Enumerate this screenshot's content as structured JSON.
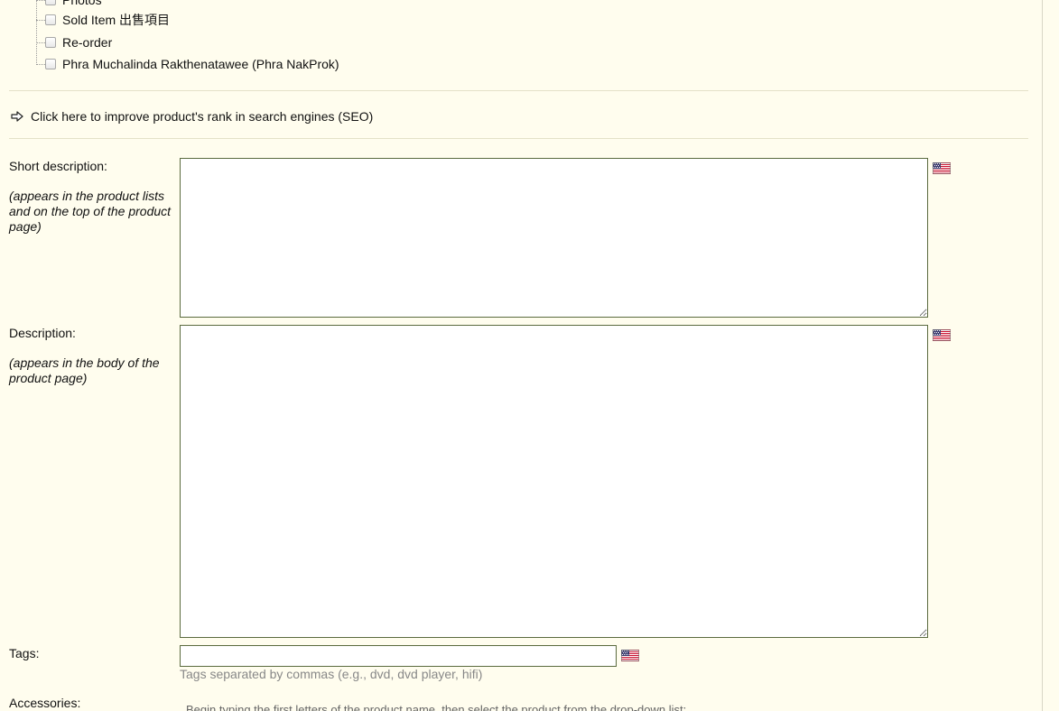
{
  "category_tree": {
    "items": [
      {
        "label": "Photos"
      },
      {
        "label": "Sold Item 出售項目"
      },
      {
        "label": "Re-order"
      },
      {
        "label": "Phra Muchalinda Rakthenatawee (Phra NakProk)"
      }
    ]
  },
  "seo_link": {
    "icon": "arrow-right-icon",
    "label": "Click here to improve product's rank in search engines (SEO)"
  },
  "short_description": {
    "label": "Short description:",
    "hint": "(appears in the product lists and on the top of the product page)",
    "value": "",
    "language_icon": "us-flag-icon"
  },
  "description": {
    "label": "Description:",
    "hint": "(appears in the body of the product page)",
    "value": "",
    "language_icon": "us-flag-icon"
  },
  "tags": {
    "label": "Tags:",
    "value": "",
    "hint": "Tags separated by commas (e.g., dvd, dvd player, hifi)",
    "language_icon": "us-flag-icon"
  },
  "accessories": {
    "label": "Accessories:",
    "hint": "Begin typing the first letters of the product name, then select the product from the drop-down list:"
  },
  "colors": {
    "background": "#fffdee",
    "field_border": "#5a6a3e",
    "hint_text": "#888888"
  }
}
